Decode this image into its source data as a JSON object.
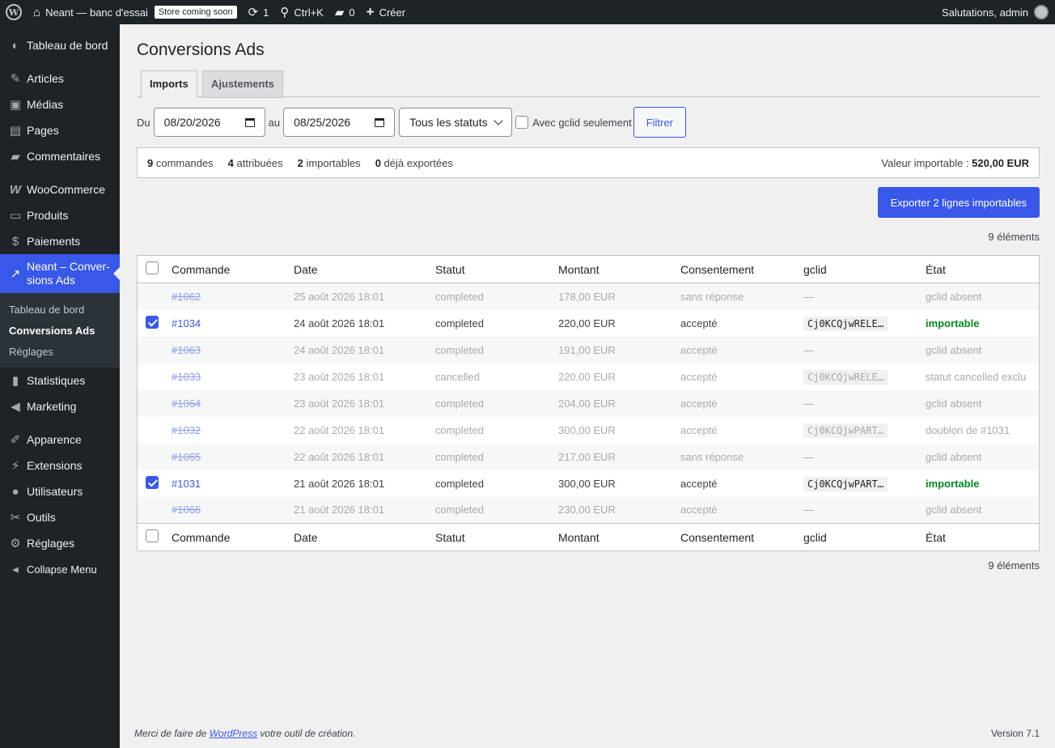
{
  "adminbar": {
    "site_name": "Neant — banc d'essai",
    "store_badge": "Store coming soon",
    "updates_count": "1",
    "search_shortcut": "Ctrl+K",
    "comments_count": "0",
    "create_label": "Créer",
    "greeting": "Salutations, admin"
  },
  "sidebar": {
    "dashboard": "Tableau de bord",
    "posts": "Articles",
    "media": "Médias",
    "pages": "Pages",
    "comments": "Commentaires",
    "woocommerce": "WooCommerce",
    "products": "Produits",
    "payments": "Paiements",
    "current": "Neant – Conver-sions Ads",
    "sub": [
      "Tableau de bord",
      "Conversions Ads",
      "Réglages"
    ],
    "stats": "Statistiques",
    "marketing": "Marketing",
    "appearance": "Apparence",
    "plugins": "Extensions",
    "users": "Utilisateurs",
    "tools": "Outils",
    "settings": "Réglages",
    "collapse": "Collapse Menu"
  },
  "page": {
    "title": "Conversions Ads",
    "tabs": [
      "Imports",
      "Ajustements"
    ]
  },
  "filters": {
    "from_label": "Du",
    "from_value": "08/20/2026",
    "to_label": "au",
    "to_value": "08/25/2026",
    "status_select": "Tous les statuts",
    "gclid_only_label": "Avec gclid seulement",
    "filter_button": "Filtrer"
  },
  "summary": {
    "orders_n": "9",
    "orders_label": "commandes",
    "attributed_n": "4",
    "attributed_label": "attribuées",
    "importable_n": "2",
    "importable_label": "importables",
    "exported_n": "0",
    "exported_label": "déjà exportées",
    "value_label": "Valeur importable :",
    "value": "520,00 EUR"
  },
  "export_button": "Exporter 2 lignes importables",
  "items_count": "9 éléments",
  "table": {
    "columns": [
      "Commande",
      "Date",
      "Statut",
      "Montant",
      "Consentement",
      "gclid",
      "État"
    ],
    "rows": [
      {
        "order": "#1062",
        "date": "25 août 2026 18:01",
        "status": "completed",
        "amount": "178,00 EUR",
        "consent": "sans réponse",
        "gclid": "—",
        "state": "gclid absent",
        "checked": false,
        "muted": true
      },
      {
        "order": "#1034",
        "date": "24 août 2026 18:01",
        "status": "completed",
        "amount": "220,00 EUR",
        "consent": "accepté",
        "gclid": "Cj0KCQjwRELE…",
        "state": "importable",
        "checked": true,
        "muted": false
      },
      {
        "order": "#1063",
        "date": "24 août 2026 18:01",
        "status": "completed",
        "amount": "191,00 EUR",
        "consent": "accepté",
        "gclid": "—",
        "state": "gclid absent",
        "checked": false,
        "muted": true
      },
      {
        "order": "#1033",
        "date": "23 août 2026 18:01",
        "status": "cancelled",
        "amount": "220,00 EUR",
        "consent": "accepté",
        "gclid": "Cj0KCQjwRELE…",
        "state": "statut cancelled exclu",
        "checked": false,
        "muted": true
      },
      {
        "order": "#1064",
        "date": "23 août 2026 18:01",
        "status": "completed",
        "amount": "204,00 EUR",
        "consent": "accepté",
        "gclid": "—",
        "state": "gclid absent",
        "checked": false,
        "muted": true
      },
      {
        "order": "#1032",
        "date": "22 août 2026 18:01",
        "status": "completed",
        "amount": "300,00 EUR",
        "consent": "accepté",
        "gclid": "Cj0KCQjwPART…",
        "state": "doublon de #1031",
        "checked": false,
        "muted": true
      },
      {
        "order": "#1065",
        "date": "22 août 2026 18:01",
        "status": "completed",
        "amount": "217,00 EUR",
        "consent": "sans réponse",
        "gclid": "—",
        "state": "gclid absent",
        "checked": false,
        "muted": true
      },
      {
        "order": "#1031",
        "date": "21 août 2026 18:01",
        "status": "completed",
        "amount": "300,00 EUR",
        "consent": "accepté",
        "gclid": "Cj0KCQjwPART…",
        "state": "importable",
        "checked": true,
        "muted": false
      },
      {
        "order": "#1066",
        "date": "21 août 2026 18:01",
        "status": "completed",
        "amount": "230,00 EUR",
        "consent": "accepté",
        "gclid": "—",
        "state": "gclid absent",
        "checked": false,
        "muted": true
      }
    ]
  },
  "footer": {
    "thanks_pre": "Merci de faire de",
    "thanks_link": "WordPress",
    "thanks_post": "votre outil de création.",
    "version": "Version 7.1"
  },
  "colors": {
    "accent": "#3858e9",
    "adminbar": "#1d2327",
    "success": "#008a20"
  }
}
